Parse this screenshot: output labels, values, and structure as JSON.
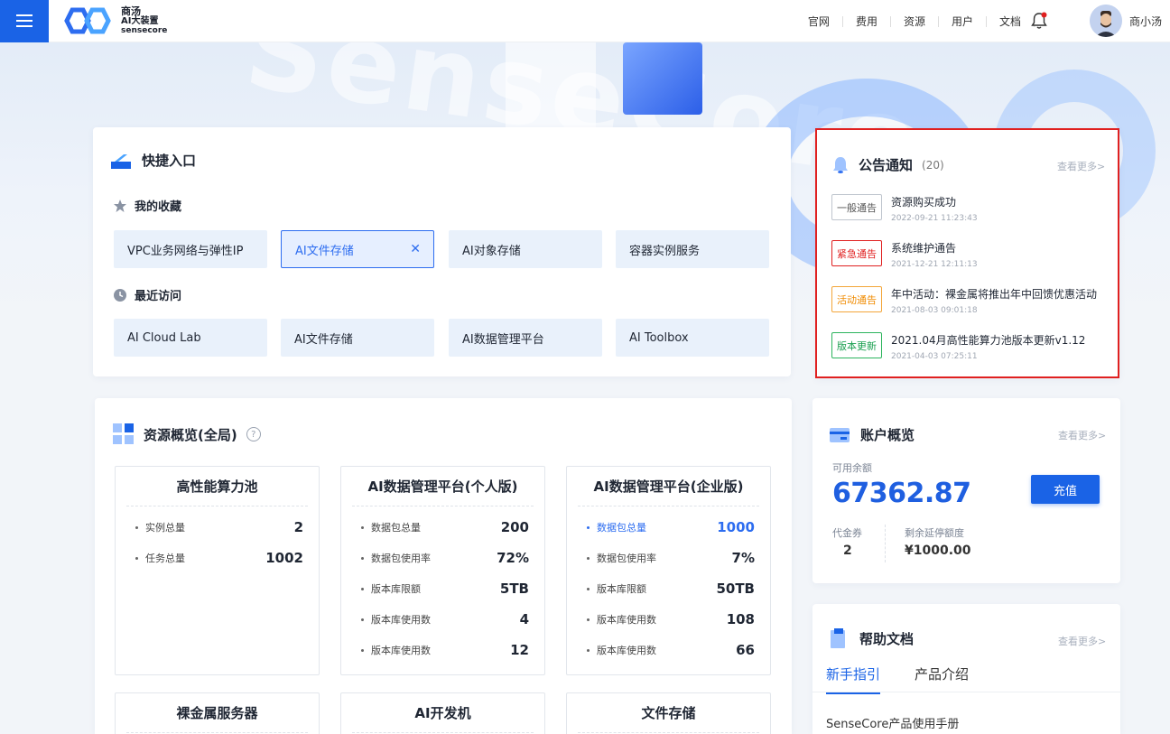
{
  "brand": {
    "line1": "商汤",
    "line2": "AI大装置",
    "line3": "sensecore"
  },
  "nav": [
    "官网",
    "费用",
    "资源",
    "用户",
    "文档"
  ],
  "user": {
    "name": "商小汤"
  },
  "quick": {
    "title": "快捷入口",
    "favorites_label": "我的收藏",
    "favorites": [
      "VPC业务网络与弹性IP",
      "AI文件存储",
      "AI对象存储",
      "容器实例服务"
    ],
    "recent_label": "最近访问",
    "recent": [
      "AI Cloud Lab",
      "AI文件存储",
      "AI数据管理平台",
      "AI Toolbox"
    ]
  },
  "notices": {
    "title": "公告通知",
    "count": "(20)",
    "more": "查看更多>",
    "items": [
      {
        "tag": "一般通告",
        "title": "资源购买成功",
        "time": "2022-09-21  11:23:43"
      },
      {
        "tag": "紧急通告",
        "title": "系统维护通告",
        "time": "2021-12-21  12:11:13"
      },
      {
        "tag": "活动通告",
        "title": "年中活动：裸金属将推出年中回馈优惠活动",
        "time": "2021-08-03  09:01:18"
      },
      {
        "tag": "版本更新",
        "title": "2021.04月高性能算力池版本更新v1.12",
        "time": "2021-04-03  07:25:11"
      }
    ]
  },
  "resources": {
    "title": "资源概览(全局)",
    "help": "?",
    "boxes": [
      {
        "title": "高性能算力池",
        "rows": [
          {
            "label": "实例总量",
            "value": "2"
          },
          {
            "label": "任务总量",
            "value": "1002"
          }
        ]
      },
      {
        "title": "AI数据管理平台(个人版)",
        "rows": [
          {
            "label": "数据包总量",
            "value": "200"
          },
          {
            "label": "数据包使用率",
            "value": "72%"
          },
          {
            "label": "版本库限额",
            "value": "5TB"
          },
          {
            "label": "版本库使用数",
            "value": "4"
          },
          {
            "label": "版本库使用数",
            "value": "12"
          }
        ]
      },
      {
        "title": "AI数据管理平台(企业版)",
        "rows": [
          {
            "label": "数据包总量",
            "value": "1000"
          },
          {
            "label": "数据包使用率",
            "value": "7%"
          },
          {
            "label": "版本库限额",
            "value": "50TB"
          },
          {
            "label": "版本库使用数",
            "value": "108"
          },
          {
            "label": "版本库使用数",
            "value": "66"
          }
        ]
      },
      {
        "title": "裸金属服务器",
        "rows": []
      },
      {
        "title": "AI开发机",
        "rows": []
      },
      {
        "title": "文件存储",
        "rows": []
      }
    ]
  },
  "account": {
    "title": "账户概览",
    "more": "查看更多>",
    "balance_label": "可用余额",
    "balance": "67362.87",
    "recharge": "充值",
    "voucher_label": "代金券",
    "voucher": "2",
    "credit_label": "剩余延停额度",
    "credit": "¥1000.00"
  },
  "help": {
    "title": "帮助文档",
    "more": "查看更多>",
    "tabs": [
      "新手指引",
      "产品介绍"
    ],
    "first_doc": "SenseCore产品使用手册"
  },
  "colors": {
    "primary": "#1a63e6",
    "urgent": "#e02020",
    "activity": "#f08b00",
    "version": "#1ba050"
  }
}
